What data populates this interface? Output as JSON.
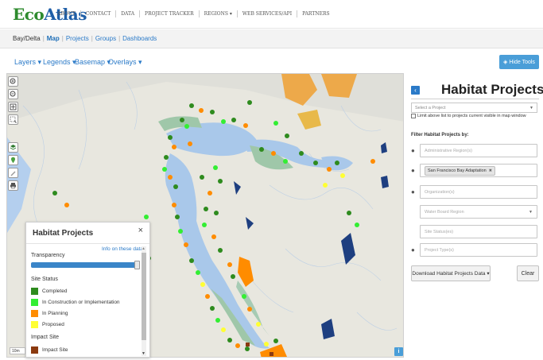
{
  "logo": {
    "brand_a": "Eco",
    "brand_b": "Atlas"
  },
  "nav": [
    "ABOUT",
    "CONTACT",
    "DATA",
    "PROJECT TRACKER",
    "REGIONS ▾",
    "WEB SERVICES/API",
    "PARTNERS"
  ],
  "breadcrumb": {
    "root": "Bay/Delta",
    "current": "Map",
    "links": [
      "Projects",
      "Groups",
      "Dashboards"
    ]
  },
  "mapbar": {
    "layers": "Layers ▾",
    "legends": "Legends ▾",
    "basemap": "Basemap ▾",
    "overlays": "Overlays ▾",
    "hide_tools": "◈ Hide Tools"
  },
  "legend": {
    "title": "Habitat Projects",
    "close": "×",
    "info_link": "Info on these data",
    "transparency_label": "Transparency",
    "transparency_value": 0.96,
    "site_status_label": "Site Status",
    "items": [
      {
        "label": "Completed",
        "color": "#2e8b1e"
      },
      {
        "label": "In Construction or Implementation",
        "color": "#33ee33"
      },
      {
        "label": "In Planning",
        "color": "#ff8c00"
      },
      {
        "label": "Proposed",
        "color": "#ffff33"
      }
    ],
    "impact_label": "Impact Site",
    "impact_item": {
      "label": "Impact Site",
      "color": "#8b3a0f"
    }
  },
  "sidebar": {
    "title": "Habitat Projects",
    "select_project_placeholder": "Select a Project",
    "limit_checkbox": "Limit above list to projects current visible in map window",
    "filter_label": "Filter Habitat Projects by:",
    "filters": [
      {
        "placeholder": "Administrative Region(s)",
        "has_pin": true
      },
      {
        "tag": "San Francisco Bay Adaptation",
        "tag_x": "✖",
        "has_pin": true
      },
      {
        "placeholder": "Organization(s)",
        "has_pin": true
      },
      {
        "placeholder": "Water Board Region",
        "has_pin": false,
        "dropdown": true
      },
      {
        "placeholder": "Site Status(es)",
        "has_pin": false
      },
      {
        "placeholder": "Project Type(s)",
        "has_pin": true
      }
    ],
    "download_label": "Download Habitat Projects Data ▾",
    "clear_label": "Clear"
  },
  "map_colors": {
    "land": "#e9e8e0",
    "water": "#a9c8ea",
    "marsh": "#9fc7a9",
    "urban": "#d8d8d2"
  },
  "scale_text": "10m"
}
